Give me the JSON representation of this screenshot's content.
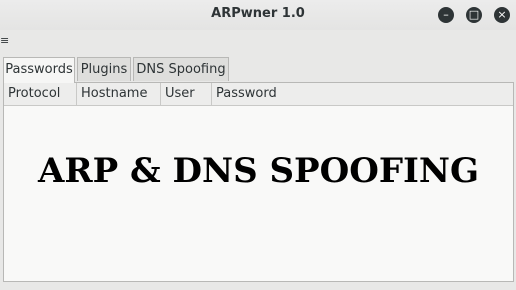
{
  "window": {
    "title": "ARPwner 1.0",
    "controls": {
      "minimize_icon": "minimize-icon",
      "maximize_icon": "maximize-icon",
      "close_icon": "close-icon"
    }
  },
  "menu": {
    "marker": "≡"
  },
  "tabs": [
    {
      "label": "Passwords",
      "active": true
    },
    {
      "label": "Plugins",
      "active": false
    },
    {
      "label": "DNS Spoofing",
      "active": false
    }
  ],
  "table": {
    "columns": [
      "Protocol",
      "Hostname",
      "User",
      "Password"
    ],
    "rows": []
  },
  "banner": {
    "text": "ARP & DNS SPOOFING"
  }
}
